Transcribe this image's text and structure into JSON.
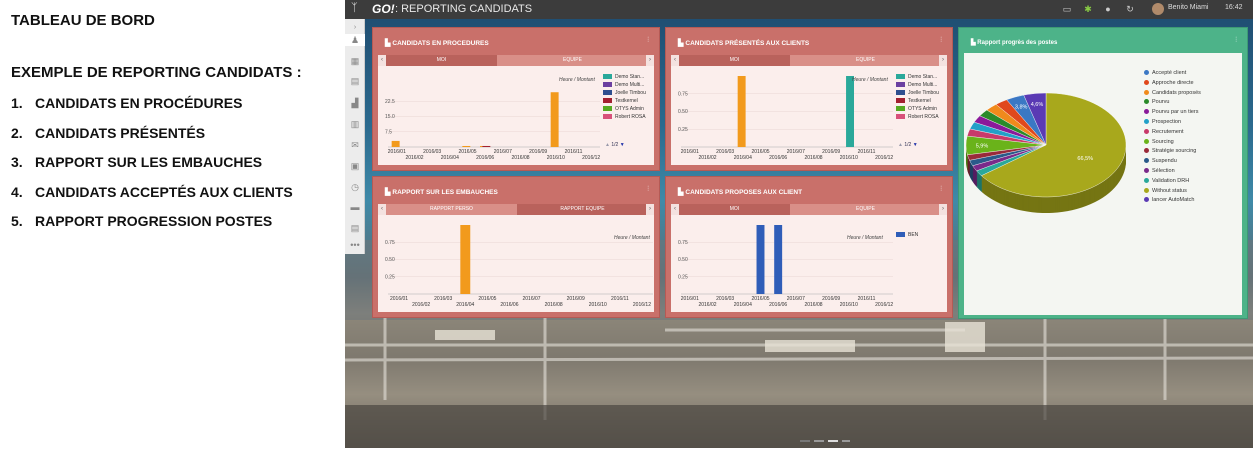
{
  "left": {
    "title": "TABLEAU DE BORD",
    "subtitle": "EXEMPLE DE REPORTING CANDIDATS :",
    "items": [
      {
        "num": "1.",
        "label": "CANDIDATS EN PROCÉDURES"
      },
      {
        "num": "2.",
        "label": "CANDIDATS PRÉSENTÉS"
      },
      {
        "num": "3.",
        "label": "RAPPORT SUR LES EMBAUCHES"
      },
      {
        "num": "4.",
        "label": "CANDIDATS ACCEPTÉS AUX CLIENTS"
      },
      {
        "num": "5.",
        "label": "RAPPORT PROGRESSION POSTES"
      }
    ]
  },
  "topbar": {
    "brand": "GO!",
    "title": ": REPORTING CANDIDATS",
    "user": "Benito Miami",
    "time": "16:42"
  },
  "panels": {
    "p1": {
      "title": "CANDIDATS EN PROCEDURES",
      "tab_left": "MOI",
      "tab_right": "EQUIPE",
      "unit": "Heure / Montant",
      "pager": "1/2",
      "legend": [
        {
          "label": "Demo Stan...",
          "color": "#2aa89a"
        },
        {
          "label": "Demo Multi...",
          "color": "#6b3fa0"
        },
        {
          "label": "Joelle Timbou",
          "color": "#2f4f8f"
        },
        {
          "label": "Testkernel",
          "color": "#a32030"
        },
        {
          "label": "OTYS Admin",
          "color": "#55aa22"
        },
        {
          "label": "Robert ROSA",
          "color": "#d8507a"
        }
      ]
    },
    "p2": {
      "title": "CANDIDATS PRÉSENTÉS AUX CLIENTS",
      "tab_left": "MOI",
      "tab_right": "EQUIPE",
      "unit": "Heure / Montant",
      "pager": "1/2",
      "legend": [
        {
          "label": "Demo Stan...",
          "color": "#2aa89a"
        },
        {
          "label": "Demo Multi...",
          "color": "#6b3fa0"
        },
        {
          "label": "Joelle Timbou",
          "color": "#2f4f8f"
        },
        {
          "label": "Testkernel",
          "color": "#a32030"
        },
        {
          "label": "OTYS Admin",
          "color": "#55aa22"
        },
        {
          "label": "Robert ROSA",
          "color": "#d8507a"
        }
      ]
    },
    "p3": {
      "title": "RAPPORT SUR LES EMBAUCHES",
      "tab_left": "RAPPORT PERSO",
      "tab_right": "RAPPORT EQUIPE",
      "unit": "Heure / Montant"
    },
    "p4": {
      "title": "CANDIDATS PROPOSES AUX CLIENT",
      "tab_left": "MOI",
      "tab_right": "EQUIPE",
      "unit": "Heure / Montant",
      "legend": [
        {
          "label": "BEN",
          "color": "#2f5db8"
        }
      ]
    },
    "p5": {
      "title": "Rapport progrès des postes"
    }
  },
  "chart_data": [
    {
      "type": "bar",
      "title": "CANDIDATS EN PROCEDURES",
      "categories": [
        "2016/01",
        "2016/02",
        "2016/03",
        "2016/04",
        "2016/05",
        "2016/06",
        "2016/07",
        "2016/08",
        "2016/09",
        "2016/10",
        "2016/11",
        "2016/12"
      ],
      "yticks": [
        "7.5",
        "15.0",
        "22.5"
      ],
      "ylim": [
        0,
        35
      ],
      "series": [
        {
          "name": "Demo Stan...",
          "color": "#f29a1c",
          "values": [
            3,
            0,
            0,
            0,
            0.5,
            0.5,
            0,
            0,
            0,
            27,
            0,
            0
          ]
        },
        {
          "name": "Testkernel",
          "color": "#a32030",
          "values": [
            0,
            0,
            0,
            0,
            0,
            0.5,
            0,
            0,
            0,
            0,
            0,
            0
          ]
        }
      ]
    },
    {
      "type": "bar",
      "title": "CANDIDATS PRÉSENTÉS AUX CLIENTS",
      "categories": [
        "2016/01",
        "2016/02",
        "2016/03",
        "2016/04",
        "2016/05",
        "2016/06",
        "2016/07",
        "2016/08",
        "2016/09",
        "2016/10",
        "2016/11",
        "2016/12"
      ],
      "yticks": [
        "0.25",
        "0.50",
        "0.75"
      ],
      "ylim": [
        0,
        1
      ],
      "series": [
        {
          "name": "Demo Stan...",
          "color": "#f29a1c",
          "values": [
            0,
            0,
            0,
            1,
            0,
            0,
            0,
            0,
            0,
            0,
            0,
            0
          ]
        },
        {
          "name": "Joelle Timbou",
          "color": "#2aa89a",
          "values": [
            0,
            0,
            0,
            0,
            0,
            0,
            0,
            0,
            0,
            1,
            0,
            0
          ]
        }
      ]
    },
    {
      "type": "bar",
      "title": "RAPPORT SUR LES EMBAUCHES",
      "categories": [
        "2016/01",
        "2016/02",
        "2016/03",
        "2016/04",
        "2016/05",
        "2016/06",
        "2016/07",
        "2016/08",
        "2016/09",
        "2016/10",
        "2016/11",
        "2016/12"
      ],
      "yticks": [
        "0.25",
        "0.50",
        "0.75"
      ],
      "ylim": [
        0,
        1
      ],
      "series": [
        {
          "color": "#f29a1c",
          "values": [
            0,
            0,
            0,
            1,
            0,
            0,
            0,
            0,
            0,
            0,
            0,
            0
          ]
        }
      ]
    },
    {
      "type": "bar",
      "title": "CANDIDATS PROPOSES AUX CLIENT",
      "categories": [
        "2016/01",
        "2016/02",
        "2016/03",
        "2016/04",
        "2016/05",
        "2016/06",
        "2016/07",
        "2016/08",
        "2016/09",
        "2016/10",
        "2016/11",
        "2016/12"
      ],
      "yticks": [
        "0.25",
        "0.50",
        "0.75"
      ],
      "ylim": [
        0,
        1
      ],
      "series": [
        {
          "name": "BEN",
          "color": "#2f5db8",
          "values": [
            0,
            0,
            0,
            0,
            1,
            1,
            0,
            0,
            0,
            0,
            0,
            0
          ]
        }
      ]
    },
    {
      "type": "pie",
      "title": "Rapport progrès des postes",
      "slices": [
        {
          "label": "Accepté client",
          "value": 3.8,
          "color": "#3b78c4",
          "text": "3,8%"
        },
        {
          "label": "Approche directe",
          "value": 2.6,
          "color": "#e0481c"
        },
        {
          "label": "Candidats proposés",
          "value": 2.6,
          "color": "#f08a1c"
        },
        {
          "label": "Pourvu",
          "value": 2.3,
          "color": "#2a8a2a"
        },
        {
          "label": "Pourvu par un tiers",
          "value": 2.3,
          "color": "#8a1a9a"
        },
        {
          "label": "Prospection",
          "value": 2.3,
          "color": "#22a0c8"
        },
        {
          "label": "Recrutement",
          "value": 2.3,
          "color": "#c83a6a"
        },
        {
          "label": "Sourcing",
          "value": 5.9,
          "color": "#6ab31a",
          "text": "5,9%"
        },
        {
          "label": "Stratégie sourcing",
          "value": 1.8,
          "color": "#9a2a3a"
        },
        {
          "label": "Suspendu",
          "value": 1.8,
          "color": "#2a5a8a"
        },
        {
          "label": "Sélection",
          "value": 1.8,
          "color": "#7a2a8a"
        },
        {
          "label": "Validation DRH",
          "value": 1.8,
          "color": "#2aa89a"
        },
        {
          "label": "Without status",
          "value": 66.5,
          "color": "#a8a81c",
          "text": "66,5%"
        },
        {
          "label": "lancer AutoMatch",
          "value": 4.6,
          "color": "#5a3ab4",
          "text": "4,6%"
        }
      ]
    }
  ]
}
